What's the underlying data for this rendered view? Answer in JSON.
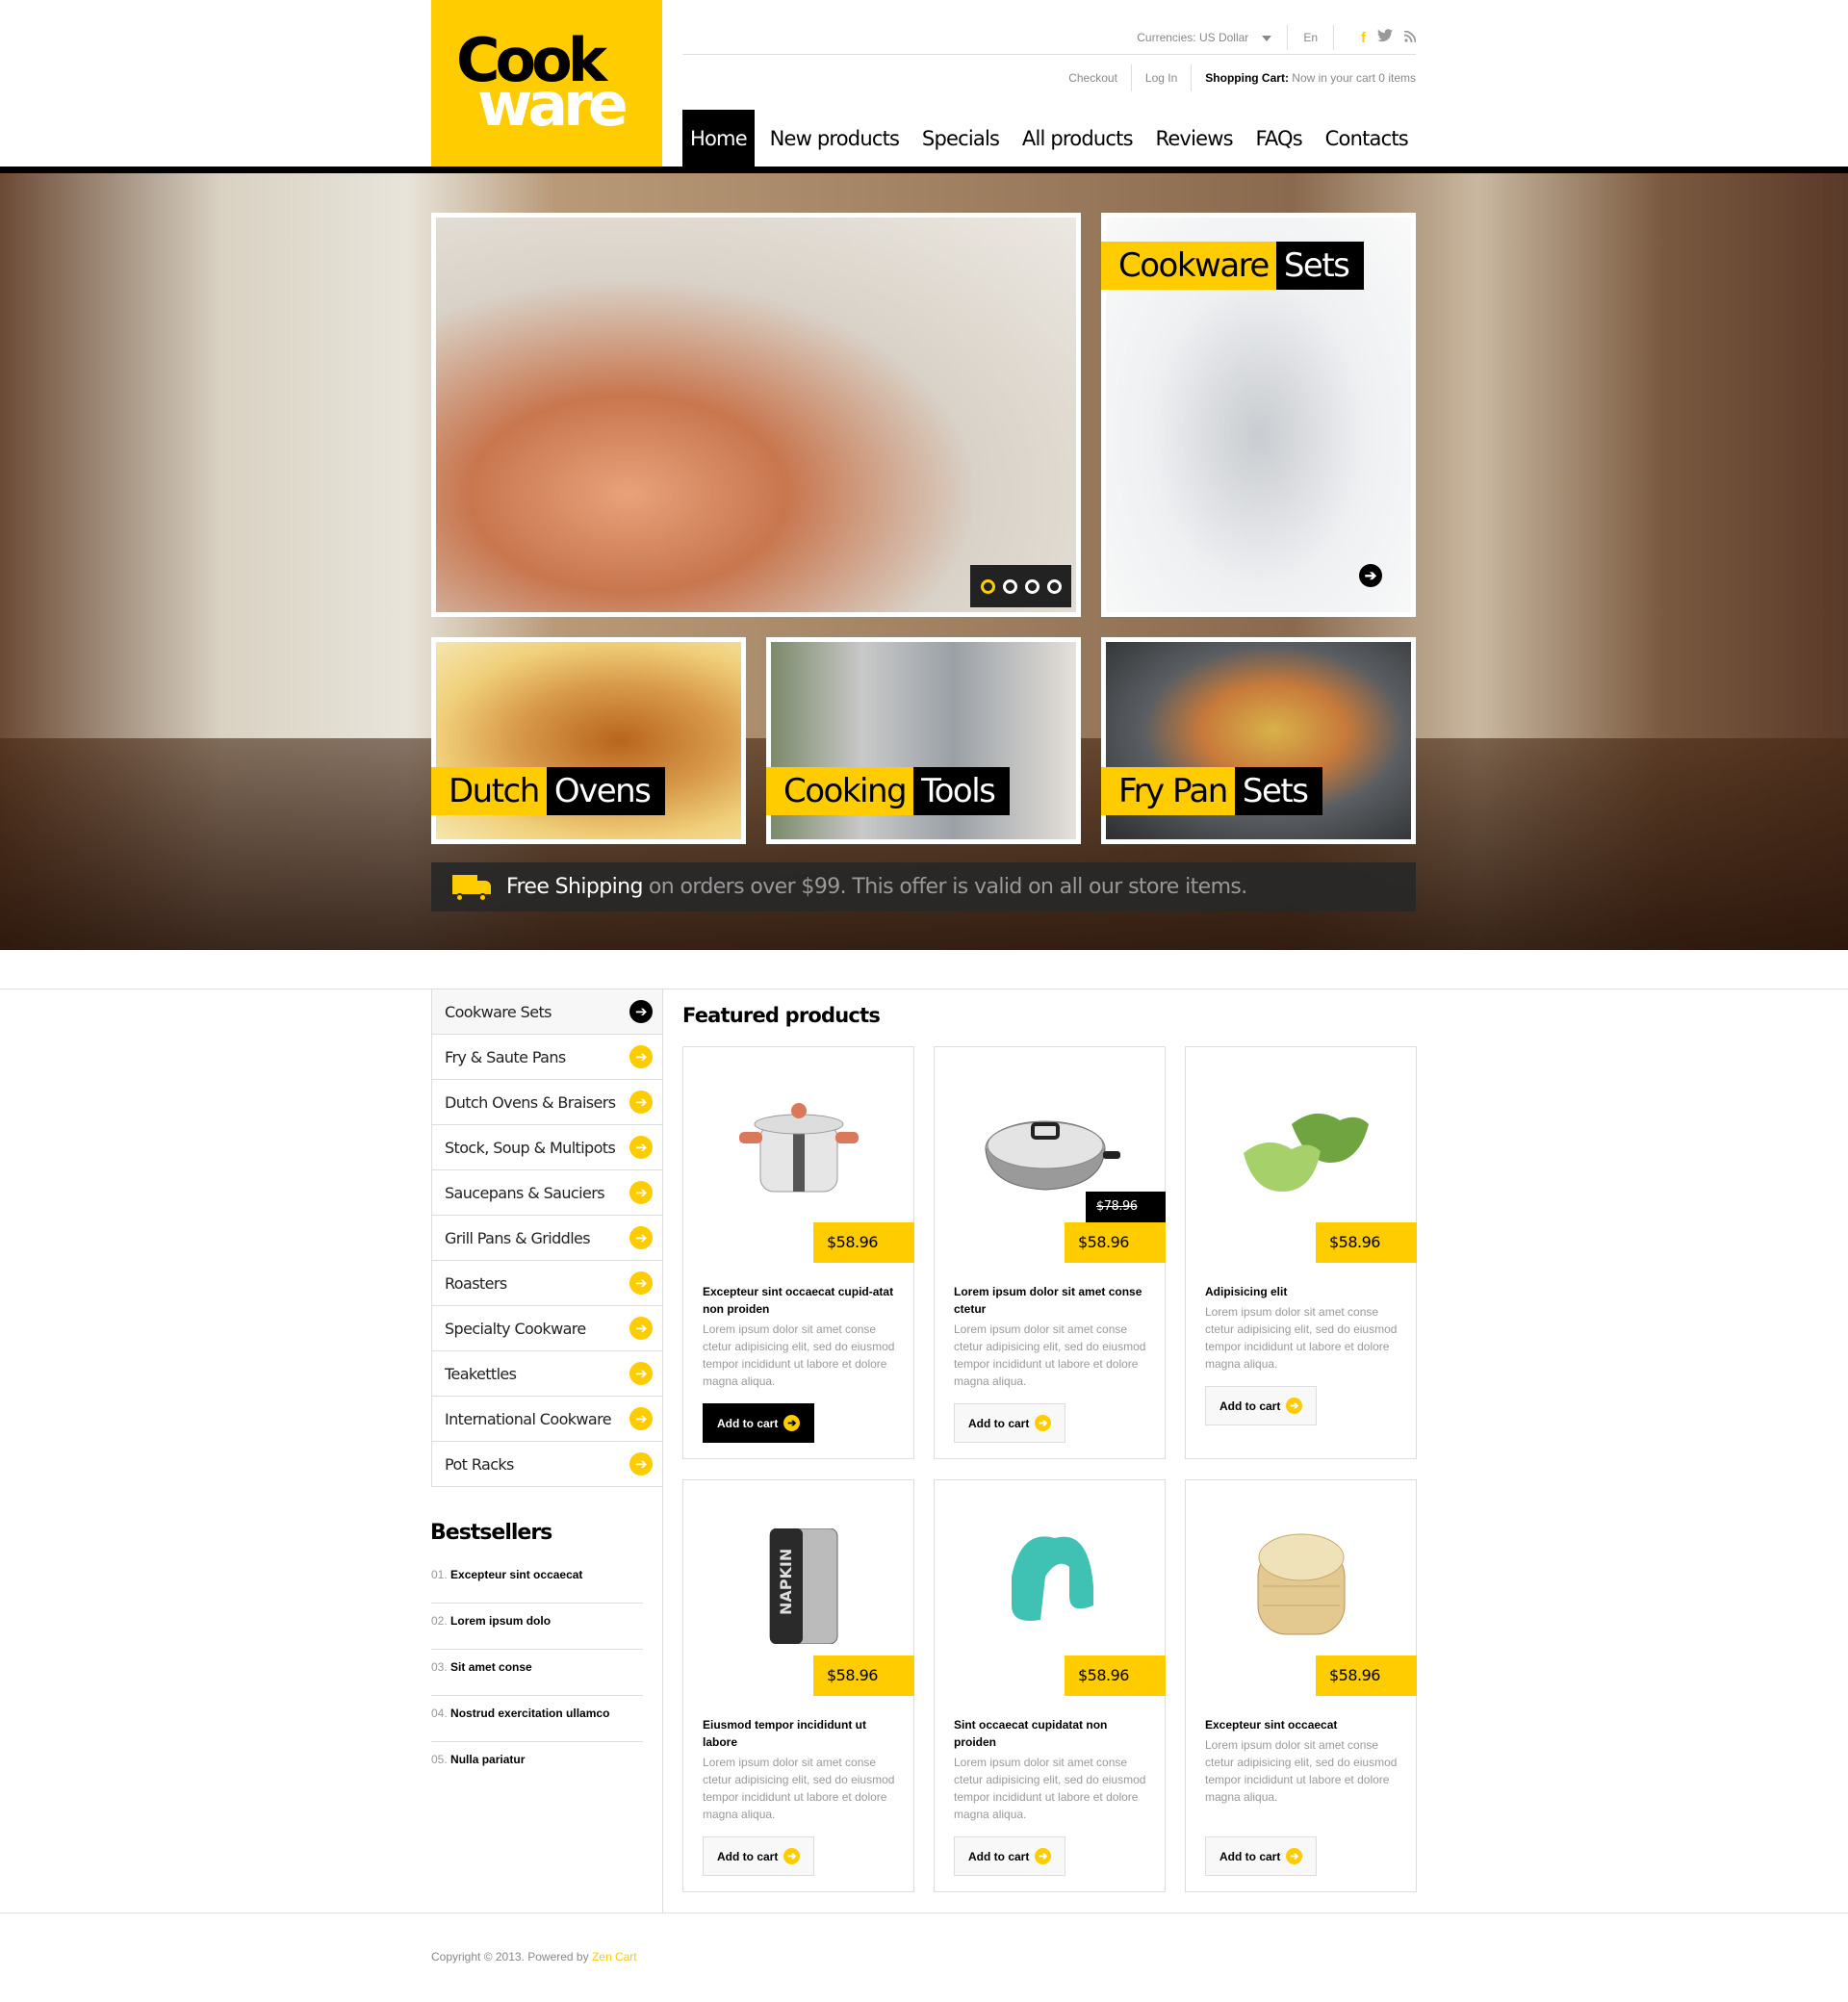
{
  "brand": {
    "line1": "Cook",
    "line2": "ware"
  },
  "topbar": {
    "currency_label": "Currencies:",
    "currency_value": "US Dollar",
    "language": "En",
    "social": [
      {
        "name": "facebook-icon",
        "glyph": "f",
        "color": "#ffcc00"
      },
      {
        "name": "twitter-icon",
        "glyph": "t",
        "color": "#999999"
      },
      {
        "name": "rss-icon",
        "glyph": "r",
        "color": "#999999"
      }
    ]
  },
  "links": {
    "checkout": "Checkout",
    "login": "Log In",
    "cart_label": "Shopping Cart:",
    "cart_status": "Now in your cart 0 items"
  },
  "nav": {
    "items": [
      "Home",
      "New products",
      "Specials",
      "All products",
      "Reviews",
      "FAQs",
      "Contacts"
    ],
    "active": "Home"
  },
  "hero": {
    "slider": {
      "total_slides": 4,
      "active_slide": 1
    },
    "banner_main": {
      "word1": "Cookware",
      "word2": "Sets"
    },
    "tiles": [
      {
        "word1": "Dutch",
        "word2": "Ovens"
      },
      {
        "word1": "Cooking",
        "word2": "Tools"
      },
      {
        "word1": "Fry Pan",
        "word2": "Sets"
      }
    ],
    "shipping": {
      "lead": "Free Shipping",
      "rest": "on orders over $99. This offer is valid on all our store items."
    }
  },
  "categories": [
    "Cookware Sets",
    "Fry & Saute Pans",
    "Dutch Ovens & Braisers",
    "Stock, Soup & Multipots",
    "Saucepans & Sauciers",
    "Grill Pans & Griddles",
    "Roasters",
    "Specialty Cookware",
    "Teakettles",
    "International Cookware",
    "Pot Racks"
  ],
  "bestsellers": {
    "title": "Bestsellers",
    "items": [
      {
        "num": "01.",
        "label": "Excepteur sint occaecat"
      },
      {
        "num": "02.",
        "label": "Lorem ipsum dolo"
      },
      {
        "num": "03.",
        "label": "Sit amet conse"
      },
      {
        "num": "04.",
        "label": "Nostrud exercitation ullamco"
      },
      {
        "num": "05.",
        "label": "Nulla pariatur"
      }
    ]
  },
  "featured": {
    "title": "Featured products",
    "add_to_cart": "Add to cart",
    "products": [
      {
        "name": "Excepteur sint occaecat cupid-atat non proiden",
        "price": "$58.96",
        "old_price": null,
        "image": "pressure-cooker",
        "desc": "Lorem ipsum dolor sit amet conse ctetur adipisicing elit, sed do eiusmod tempor incididunt ut labore et dolore magna aliqua."
      },
      {
        "name": "Lorem ipsum dolor sit amet conse ctetur",
        "price": "$58.96",
        "old_price": "$78.96",
        "image": "braiser-pot",
        "desc": "Lorem ipsum dolor sit amet conse ctetur adipisicing elit, sed do eiusmod tempor incididunt ut labore et dolore magna aliqua."
      },
      {
        "name": "Adipisicing elit",
        "price": "$58.96",
        "old_price": null,
        "image": "egg-poachers",
        "desc": "Lorem ipsum dolor sit amet conse ctetur adipisicing elit, sed do eiusmod tempor incididunt ut labore et dolore magna aliqua."
      },
      {
        "name": "Eiusmod tempor incididunt ut labore",
        "price": "$58.96",
        "old_price": null,
        "image": "napkin-holder",
        "desc": "Lorem ipsum dolor sit amet conse ctetur adipisicing elit, sed do eiusmod tempor incididunt ut labore et dolore magna aliqua."
      },
      {
        "name": "Sint occaecat cupidatat non proiden",
        "price": "$58.96",
        "old_price": null,
        "image": "sink-caddy",
        "desc": "Lorem ipsum dolor sit amet conse ctetur adipisicing elit, sed do eiusmod tempor incididunt ut labore et dolore magna aliqua."
      },
      {
        "name": "Excepteur sint occaecat",
        "price": "$58.96",
        "old_price": null,
        "image": "bamboo-steamer",
        "desc": "Lorem ipsum dolor sit amet conse ctetur adipisicing elit, sed do eiusmod tempor incididunt ut labore et dolore magna aliqua."
      }
    ]
  },
  "footer": {
    "copyright": "Copyright © 2013. Powered by",
    "powered_link": "Zen Cart"
  },
  "colors": {
    "accent": "#ffcc00",
    "dark": "#000000",
    "muted": "#999999",
    "border": "#dddddd"
  }
}
